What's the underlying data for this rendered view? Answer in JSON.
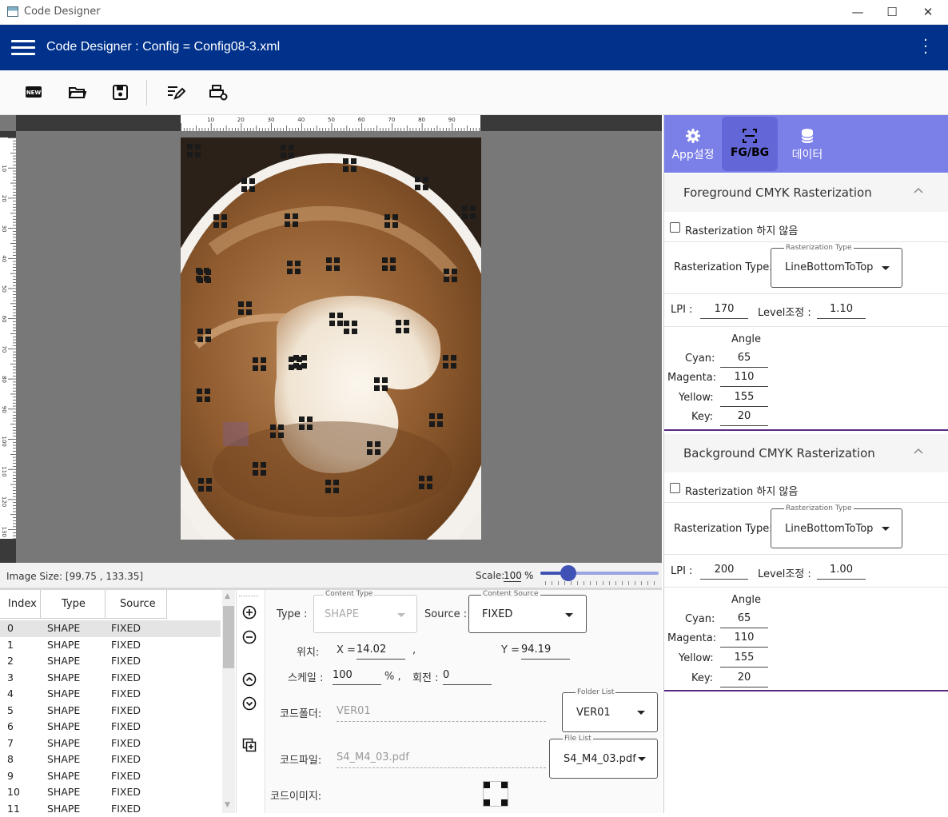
{
  "window": {
    "title": "Code Designer",
    "min": "—",
    "max": "☐",
    "close": "✕"
  },
  "appbar": {
    "title": "Code Designer : Config = Config08-3.xml"
  },
  "toolbar": {
    "new": "NEW"
  },
  "rulers": {
    "top_ticks": [
      "10",
      "20",
      "30",
      "40",
      "50",
      "60",
      "70",
      "80",
      "90"
    ],
    "left_ticks": [
      "10",
      "20",
      "30",
      "40",
      "50",
      "60",
      "70",
      "80",
      "90",
      "100",
      "110",
      "120",
      "130"
    ]
  },
  "status": {
    "image_size": "Image Size: [99.75 , 133.35]",
    "scale_label": "Scale:",
    "scale_value": "100",
    "scale_unit": "%",
    "scale_fraction": 0.2
  },
  "list": {
    "headers": [
      "Index",
      "Type",
      "Source"
    ],
    "rows": [
      [
        "0",
        "SHAPE",
        "FIXED"
      ],
      [
        "1",
        "SHAPE",
        "FIXED"
      ],
      [
        "2",
        "SHAPE",
        "FIXED"
      ],
      [
        "3",
        "SHAPE",
        "FIXED"
      ],
      [
        "4",
        "SHAPE",
        "FIXED"
      ],
      [
        "5",
        "SHAPE",
        "FIXED"
      ],
      [
        "6",
        "SHAPE",
        "FIXED"
      ],
      [
        "7",
        "SHAPE",
        "FIXED"
      ],
      [
        "8",
        "SHAPE",
        "FIXED"
      ],
      [
        "9",
        "SHAPE",
        "FIXED"
      ],
      [
        "10",
        "SHAPE",
        "FIXED"
      ],
      [
        "11",
        "SHAPE",
        "FIXED"
      ]
    ]
  },
  "props": {
    "type_label": "Type :",
    "content_type_float": "Content Type",
    "content_type_value": "SHAPE",
    "source_label": "Source :",
    "content_source_float": "Content Source",
    "content_source_value": "FIXED",
    "pos_label": "위치:",
    "x_label": "X =",
    "x_value": "14.02",
    "comma": ",",
    "y_label": "Y =",
    "y_value": "94.19",
    "scale_label": "스케일 :",
    "scale_value": "100",
    "scale_unit": "%  ,",
    "rotation_label": "회전 :",
    "rotation_value": "0",
    "folder_label": "코드폴더:",
    "folder_value": "VER01",
    "folder_list_float": "Folder List",
    "folder_list_value": "VER01",
    "file_label": "코드파일:",
    "file_value": "S4_M4_03.pdf",
    "file_list_float": "File List",
    "file_list_value": "S4_M4_03.pdf",
    "image_label": "코드이미지:"
  },
  "tabs": [
    {
      "label": "App설정",
      "icon": "gear-icon"
    },
    {
      "label": "FG/BG",
      "icon": "scan-frame-icon"
    },
    {
      "label": "데이터",
      "icon": "database-icon"
    }
  ],
  "fg": {
    "title": "Foreground CMYK Rasterization",
    "no_raster": "Rasterization 하지 않음",
    "rtype_label": "Rasterization Type:",
    "rtype_float": "Rasterization Type",
    "rtype_value": "LineBottomToTop",
    "lpi_label": "LPI :",
    "lpi_value": "170",
    "level_label": "Level조정 :",
    "level_value": "1.10",
    "angle_title": "Angle",
    "cyan_label": "Cyan:",
    "cyan": "65",
    "magenta_label": "Magenta:",
    "magenta": "110",
    "yellow_label": "Yellow:",
    "yellow": "155",
    "key_label": "Key:",
    "key": "20"
  },
  "bg": {
    "title": "Background CMYK Rasterization",
    "no_raster": "Rasterization 하지 않음",
    "rtype_label": "Rasterization Type:",
    "rtype_float": "Rasterization Type",
    "rtype_value": "LineBottomToTop",
    "lpi_label": "LPI :",
    "lpi_value": "200",
    "level_label": "Level조정 :",
    "level_value": "1.00",
    "angle_title": "Angle",
    "cyan_label": "Cyan:",
    "cyan": "65",
    "magenta_label": "Magenta:",
    "magenta": "110",
    "yellow_label": "Yellow:",
    "yellow": "155",
    "key_label": "Key:",
    "key": "20"
  },
  "colors": {
    "appbar": "#00328c",
    "tabs": "#7b7fe8",
    "accent": "#3f51b5"
  }
}
